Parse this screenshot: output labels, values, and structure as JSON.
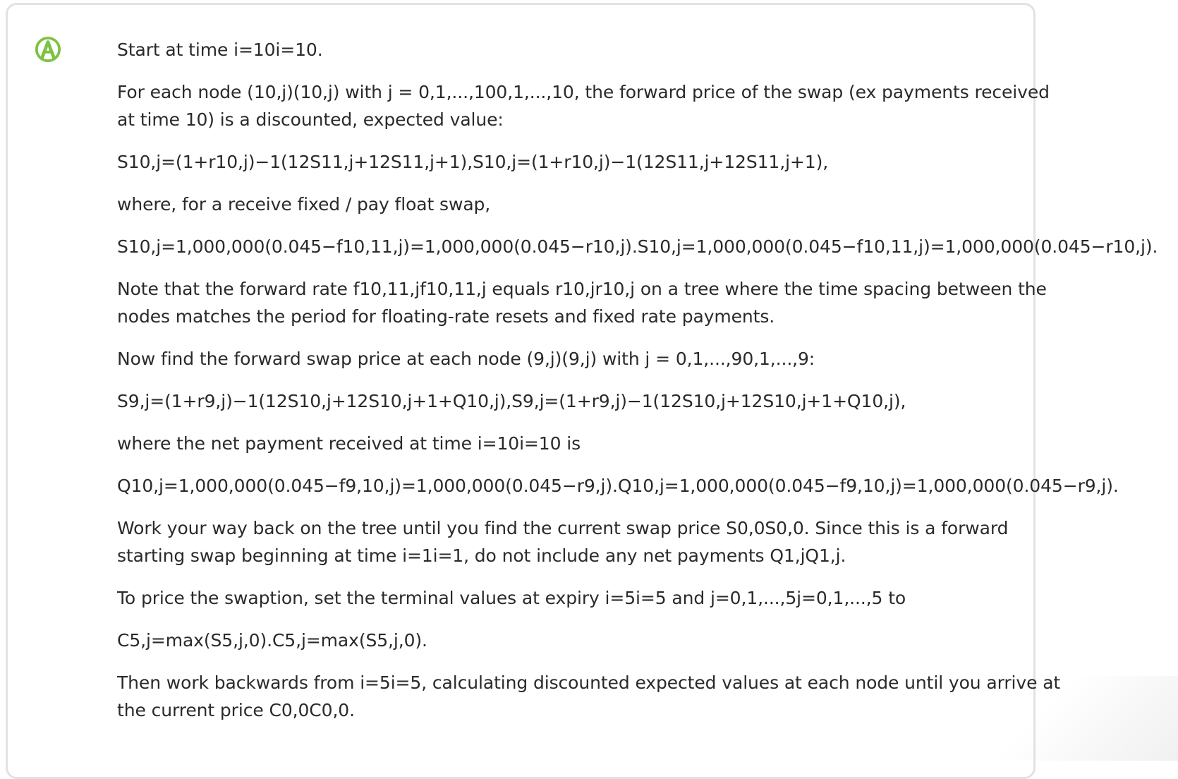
{
  "answer": {
    "avatar_icon": "answer-badge-icon",
    "avatar_letter": "A",
    "avatar_color": "#7dc242",
    "paragraphs": [
      "Start at time i=10i=10.",
      "For each node (10,j)(10,j) with j = 0,1,...,100,1,...,10, the forward price of the swap (ex payments received at time 10) is a discounted, expected value:",
      "S10,j=(1+r10,j)−1(12S11,j+12S11,j+1),S10,j=(1+r10,j)−1(12S11,j+12S11,j+1),",
      "where, for a receive fixed / pay float swap,",
      "S10,j=1,000,000(0.045−f10,11,j)=1,000,000(0.045−r10,j).S10,j=1,000,000(0.045−f10,11,j)=1,000,000(0.045−r10,j).",
      "Note that the forward rate f10,11,jf10,11,j equals r10,jr10,j on a tree where the time spacing between the nodes matches the period for floating-rate resets and fixed rate payments.",
      "Now find the forward swap price at each node (9,j)(9,j) with j = 0,1,...,90,1,...,9:",
      "S9,j=(1+r9,j)−1(12S10,j+12S10,j+1+Q10,j),S9,j=(1+r9,j)−1(12S10,j+12S10,j+1+Q10,j),",
      "where the net payment received at time i=10i=10 is",
      "Q10,j=1,000,000(0.045−f9,10,j)=1,000,000(0.045−r9,j).Q10,j=1,000,000(0.045−f9,10,j)=1,000,000(0.045−r9,j).",
      "Work your way back on the tree until you find the current swap price S0,0S0,0. Since this is a forward starting swap beginning at time i=1i=1, do not include any net payments Q1,jQ1,j.",
      "To price the swaption, set the terminal values at expiry i=5i=5 and j=0,1,...,5j=0,1,...,5 to",
      "C5,j=max(S5,j,0).C5,j=max(S5,j,0).",
      "Then work backwards from i=5i=5, calculating discounted expected values at each node until you arrive at the current price C0,0C0,0."
    ]
  }
}
